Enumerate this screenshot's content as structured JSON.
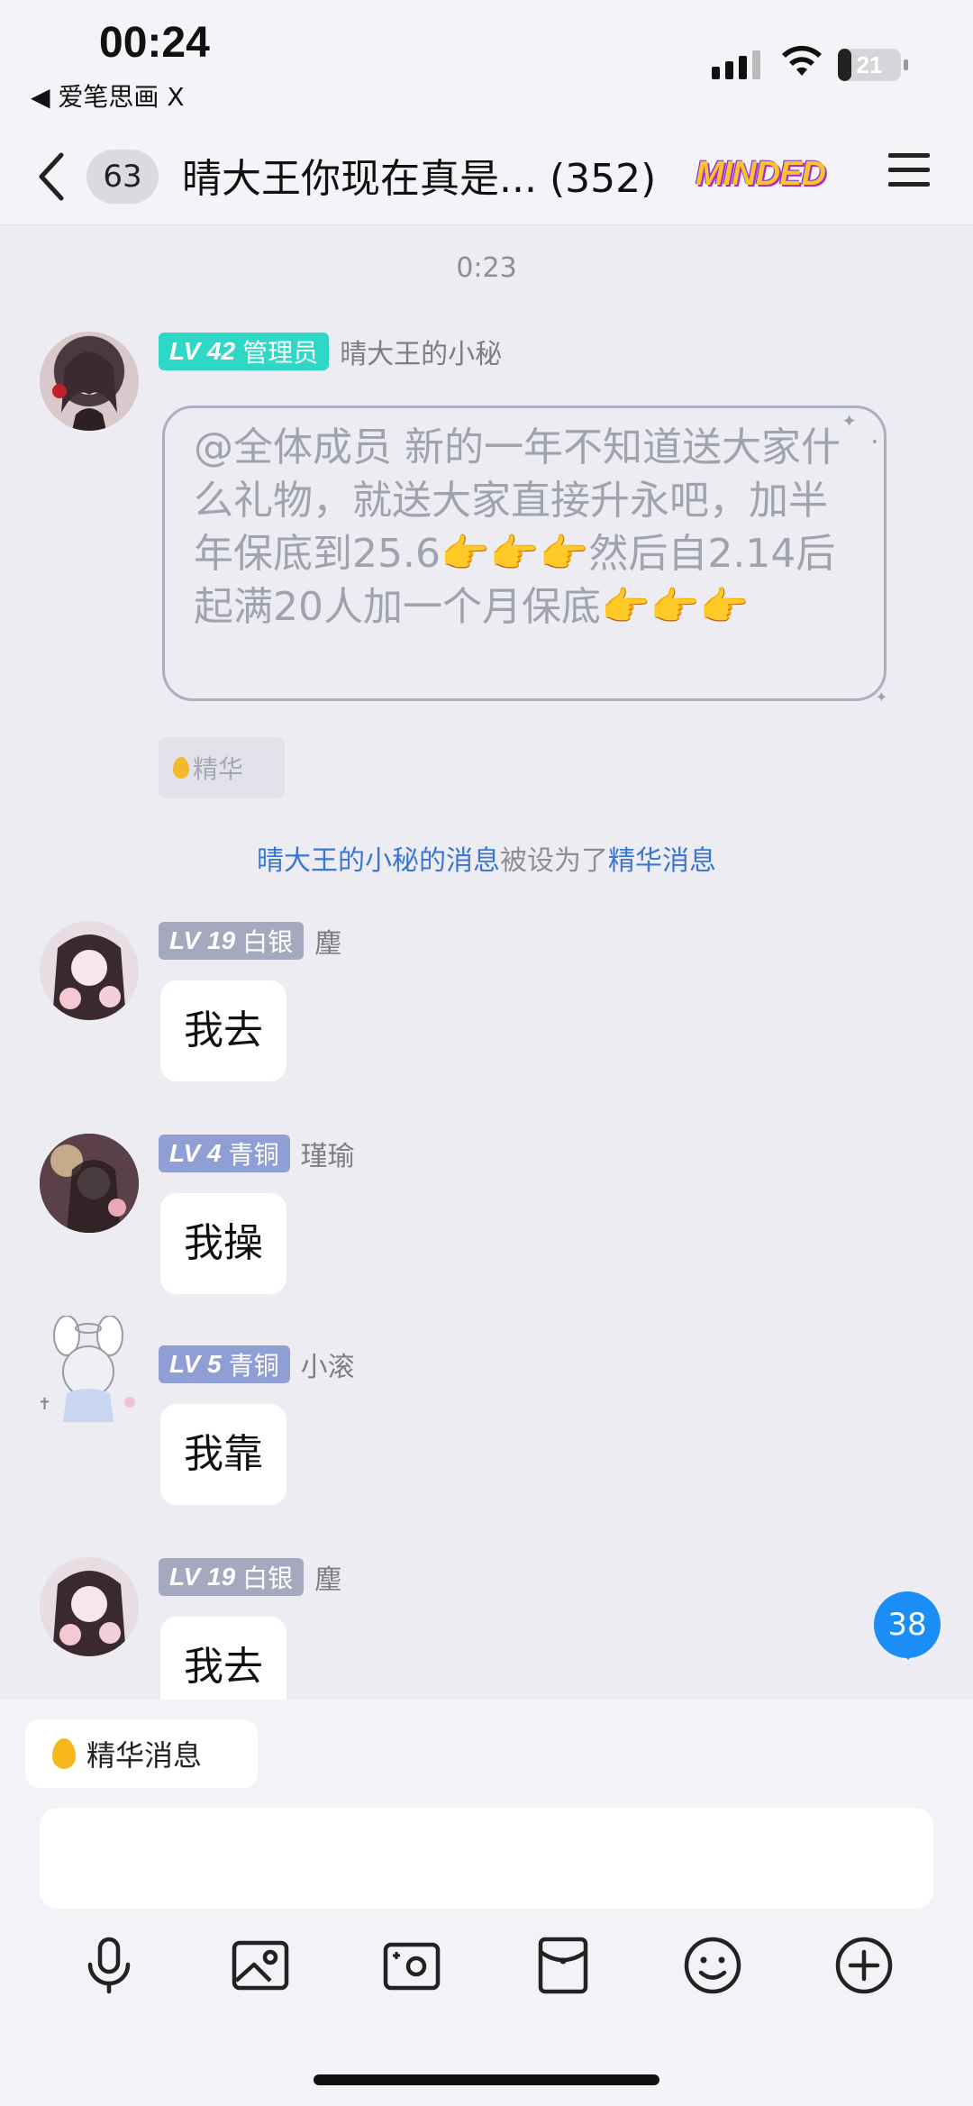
{
  "status": {
    "time": "00:24",
    "back_app": "◀ 爱笔思画 X",
    "battery": "21",
    "battery_level": 0.21
  },
  "header": {
    "unread": "63",
    "title": "晴大王你现在真是... (352)",
    "brand_badge": "MINDED"
  },
  "chat": {
    "timestamp": "0:23",
    "notice_msg": {
      "level": "LV 42",
      "role": "管理员",
      "nick": "晴大王的小秘",
      "text": "@全体成员 新的一年不知道送大家什么礼物，就送大家直接升永吧，加半年保底到25.6👉👉👉然后自2.14后起满20人加一个月保底👉👉👉",
      "essence_tag": "精华"
    },
    "system": {
      "name": "晴大王的小秘的消息",
      "middle": "被设为了",
      "target": "精华消息"
    },
    "messages": [
      {
        "level": "LV 19",
        "tier": "白银",
        "nick": "麈",
        "text": "我去"
      },
      {
        "level": "LV 4",
        "tier": "青铜",
        "nick": "瑾瑜",
        "text": "我操"
      },
      {
        "level": "LV 5",
        "tier": "青铜",
        "nick": "小滚",
        "text": "我靠"
      },
      {
        "level": "LV 19",
        "tier": "白银",
        "nick": "麈",
        "text": "我去"
      }
    ],
    "new_count": "38"
  },
  "bottom": {
    "essence_chip": "精华消息",
    "input_value": ""
  },
  "colors": {
    "admin_badge": "#2fd8c6",
    "silver_badge": "#a4a9bf",
    "bronze_badge": "#8f9fd6",
    "link": "#3a76d6",
    "accent": "#1a8ef5"
  }
}
